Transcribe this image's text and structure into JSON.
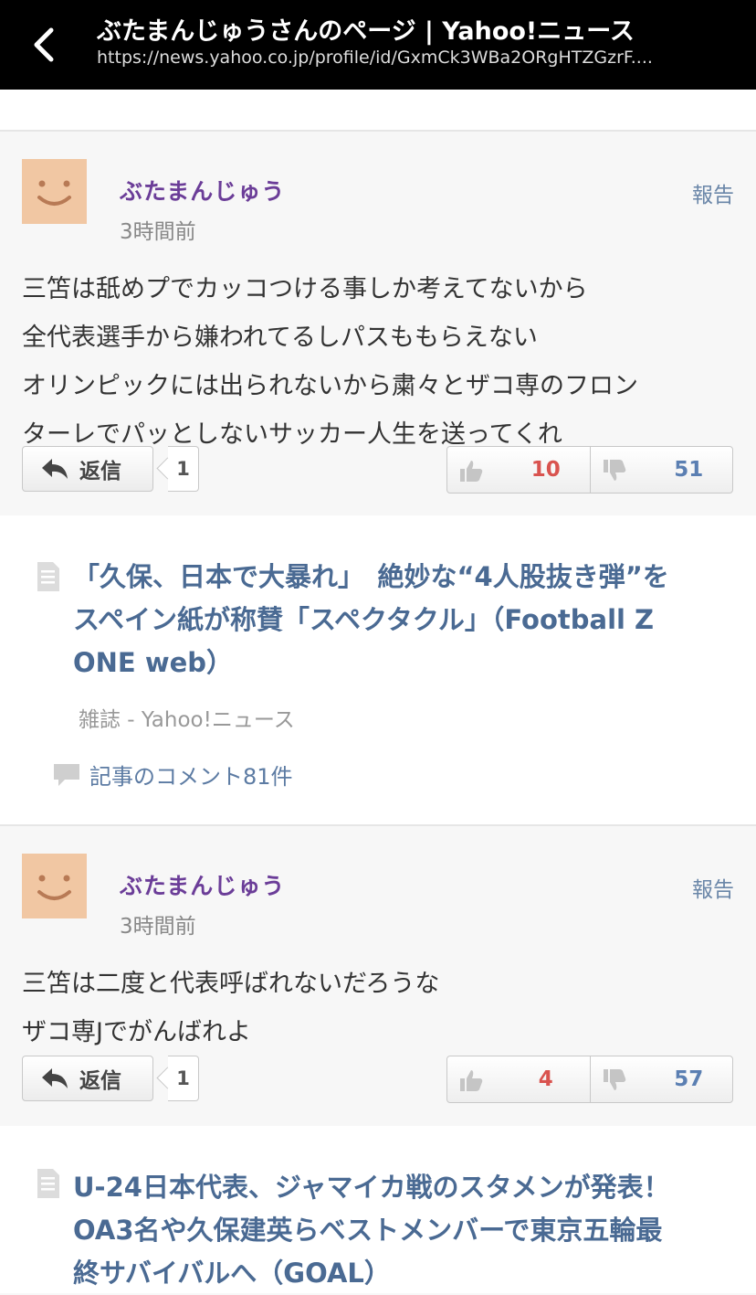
{
  "topbar": {
    "title": "ぶたまんじゅうさんのページ | Yahoo!ニュース",
    "url": "https://news.yahoo.co.jp/profile/id/GxmCk3WBa2ORgHTZGzrF...."
  },
  "comments": [
    {
      "username": "ぶたまんじゅう",
      "time": "3時間前",
      "report_label": "報告",
      "lines": [
        "三笘は舐めプでカッコつける事しか考えてないから",
        "全代表選手から嫌われてるしパスももらえない",
        "オリンピックには出られないから粛々とザコ専のフロン",
        "ターレでパッとしないサッカー人生を送ってくれ"
      ],
      "reply_label": "返信",
      "reply_count": "1",
      "likes": "10",
      "dislikes": "51"
    },
    {
      "username": "ぶたまんじゅう",
      "time": "3時間前",
      "report_label": "報告",
      "lines": [
        "三笘は二度と代表呼ばれないだろうな",
        "ザコ専Jでがんばれよ"
      ],
      "reply_label": "返信",
      "reply_count": "1",
      "likes": "4",
      "dislikes": "57"
    }
  ],
  "articles": [
    {
      "title_lines": [
        "「久保、日本で大暴れ」　絶妙な“4人股抜き弾”を",
        "スペイン紙が称賛「スペクタクル」（Football Z",
        "ONE web）"
      ],
      "source": "雑誌 - Yahoo!ニュース",
      "comments_link": "記事のコメント81件"
    },
    {
      "title_lines": [
        "U-24日本代表、ジャマイカ戦のスタメンが発表！",
        "OA3名や久保建英らベストメンバーで東京五輪最",
        "終サバイバルへ（GOAL）"
      ]
    }
  ],
  "colors": {
    "username": "#6b3d98",
    "link": "#4a6a93",
    "like": "#d9534f",
    "dislike": "#5b7fb2",
    "avatar_bg": "#f1c7a3"
  }
}
